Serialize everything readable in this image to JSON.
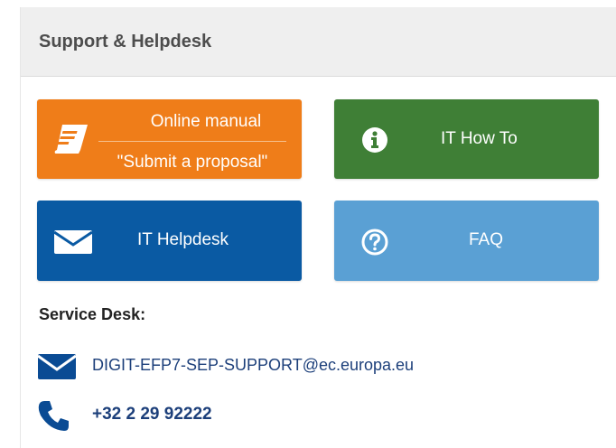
{
  "panel": {
    "title": "Support & Helpdesk"
  },
  "tiles": {
    "online_manual": {
      "title": "Online manual",
      "subtitle": "\"Submit a proposal\"",
      "icon": "book-icon",
      "color": "#ef7d19"
    },
    "it_howto": {
      "label": "IT How To",
      "icon": "info-icon",
      "color": "#3f7f36"
    },
    "it_helpdesk": {
      "label": "IT Helpdesk",
      "icon": "envelope-icon",
      "color": "#0a5aa3"
    },
    "faq": {
      "label": "FAQ",
      "icon": "question-icon",
      "color": "#5aa0d4"
    }
  },
  "service_desk": {
    "heading": "Service Desk:",
    "email": "DIGIT-EFP7-SEP-SUPPORT@ec.europa.eu",
    "phone": "+32 2 29 92222"
  }
}
